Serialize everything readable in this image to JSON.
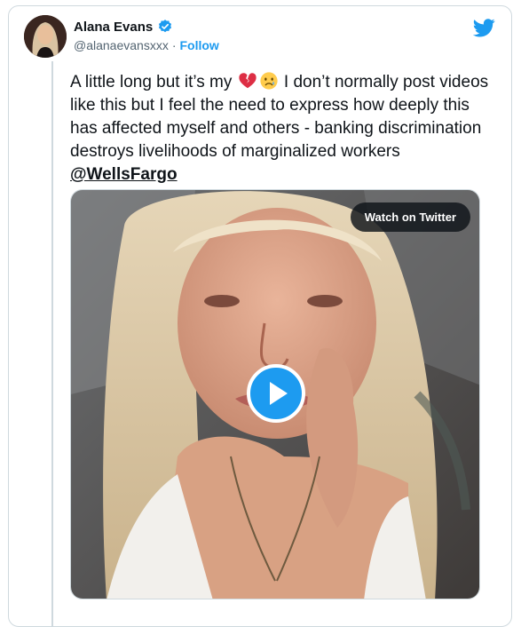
{
  "author": {
    "name": "Alana Evans",
    "handle": "@alanaevansxxx",
    "separator": "·",
    "follow_label": "Follow"
  },
  "tweet": {
    "text_part1": "A little long but it’s my ",
    "text_part2": " I don’t normally post videos like this but I feel the need to express how deeply this has affected myself and others - banking discrimination destroys livelihoods of  marginalized workers  ",
    "mention": "@WellsFargo",
    "emojis": [
      "broken-heart-icon",
      "crying-face-icon"
    ]
  },
  "media": {
    "watch_label": "Watch on Twitter",
    "play_icon": "play-icon"
  },
  "colors": {
    "accent": "#1d9bf0",
    "text": "#0f1419",
    "secondary": "#536471",
    "border": "#cfd9de"
  }
}
